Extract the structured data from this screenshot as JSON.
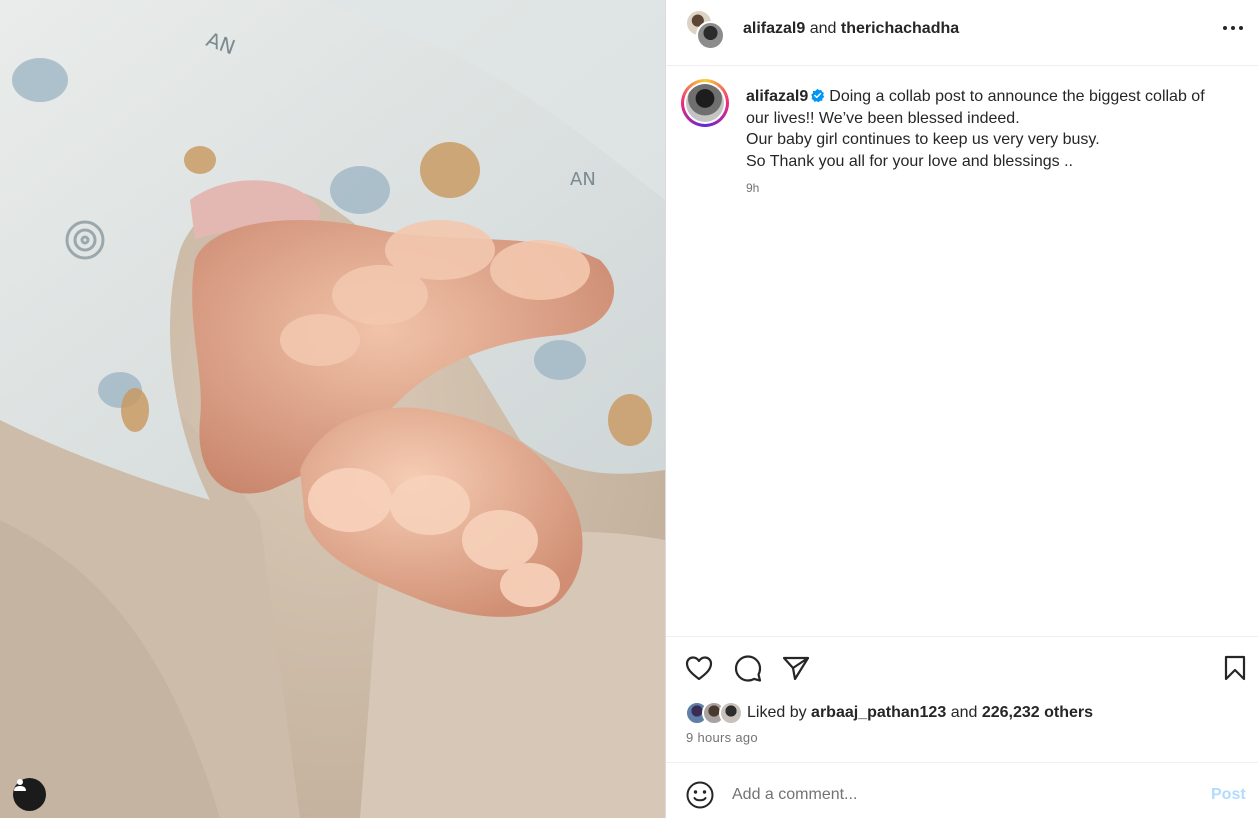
{
  "post": {
    "media": {
      "alt_subject": "baby-feet-photo"
    },
    "header": {
      "user1": "alifazal9",
      "joiner": "and",
      "user2": "therichachadha"
    },
    "caption": {
      "username": "alifazal9",
      "line1": "Doing a collab post to announce the biggest collab of our lives!! We’ve been blessed indeed.",
      "line2": "Our baby girl continues to keep us very very busy.",
      "line3": "So Thank you all for your love and blessings ..",
      "time": "9h"
    },
    "likes": {
      "prefix": "Liked by",
      "user": "arbaaj_pathan123",
      "joiner": "and",
      "others": "226,232 others"
    },
    "posted_ago": "9 hours ago",
    "comment": {
      "placeholder": "Add a comment...",
      "post_label": "Post"
    },
    "colors": {
      "verified": "#0095f6",
      "post_button_disabled": "#b3dbff",
      "secondary_text": "#737373"
    }
  }
}
